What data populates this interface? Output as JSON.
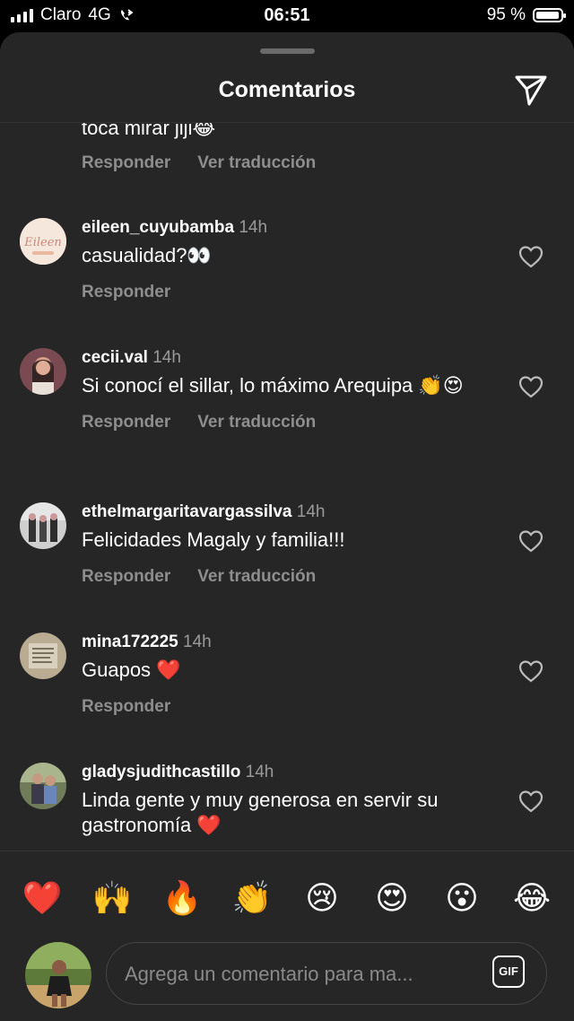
{
  "status_bar": {
    "carrier": "Claro",
    "network": "4G",
    "time": "06:51",
    "battery_percent": "95 %",
    "battery_level": 0.95
  },
  "header": {
    "title": "Comentarios"
  },
  "actions": {
    "reply": "Responder",
    "translate": "Ver traducción"
  },
  "partial_comment": {
    "text": "toca mirar jiji😂"
  },
  "comments": [
    {
      "user": "eileen_cuyubamba",
      "ago": "14h",
      "text": "casualidad?👀",
      "translate": false
    },
    {
      "user": "cecii.val",
      "ago": "14h",
      "text": "Si conocí el sillar, lo máximo Arequipa 👏😍",
      "translate": true
    },
    {
      "user": "ethelmargaritavargassilva",
      "ago": "14h",
      "text": "Felicidades Magaly y familia!!!",
      "translate": true
    },
    {
      "user": "mina172225",
      "ago": "14h",
      "text": "Guapos ❤️",
      "translate": false
    },
    {
      "user": "gladysjudithcastillo",
      "ago": "14h",
      "text": "Linda gente y muy generosa en servir su gastronomía ❤️",
      "translate": false
    }
  ],
  "emoji_bar": [
    "❤️",
    "🙌",
    "🔥",
    "👏",
    "😢",
    "😍",
    "😮",
    "😂"
  ],
  "composer": {
    "placeholder": "Agrega un comentario para ma...",
    "gif_label": "GIF"
  }
}
